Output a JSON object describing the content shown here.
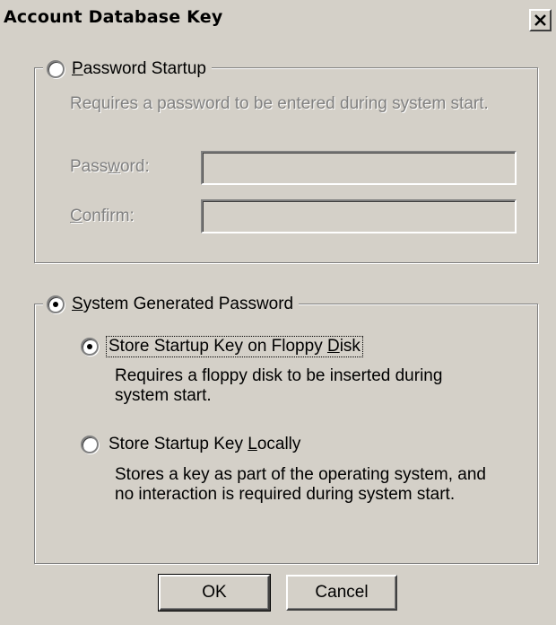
{
  "window": {
    "title": "Account Database Key"
  },
  "password_startup": {
    "label_prefix": "",
    "mnemonic": "P",
    "label_rest": "assword Startup",
    "description": "Requires a password to be entered during system start.",
    "password_label_pre": "Pass",
    "password_label_mn": "w",
    "password_label_post": "ord:",
    "password_value": "",
    "confirm_label_pre": "",
    "confirm_label_mn": "C",
    "confirm_label_post": "onfirm:",
    "confirm_value": "",
    "selected": false
  },
  "system_generated": {
    "mnemonic": "S",
    "label_rest": "ystem Generated Password",
    "selected": true,
    "floppy": {
      "label_pre": "Store Startup Key on Floppy ",
      "label_mn": "D",
      "label_post": "isk",
      "description": "Requires a floppy disk to be inserted during system start.",
      "selected": true
    },
    "local": {
      "label_pre": "Store Startup Key ",
      "label_mn": "L",
      "label_post": "ocally",
      "description": "Stores a key as part of the operating system, and no interaction is required during system start.",
      "selected": false
    }
  },
  "buttons": {
    "ok": "OK",
    "cancel": "Cancel"
  },
  "icons": {
    "close": "close-icon"
  }
}
